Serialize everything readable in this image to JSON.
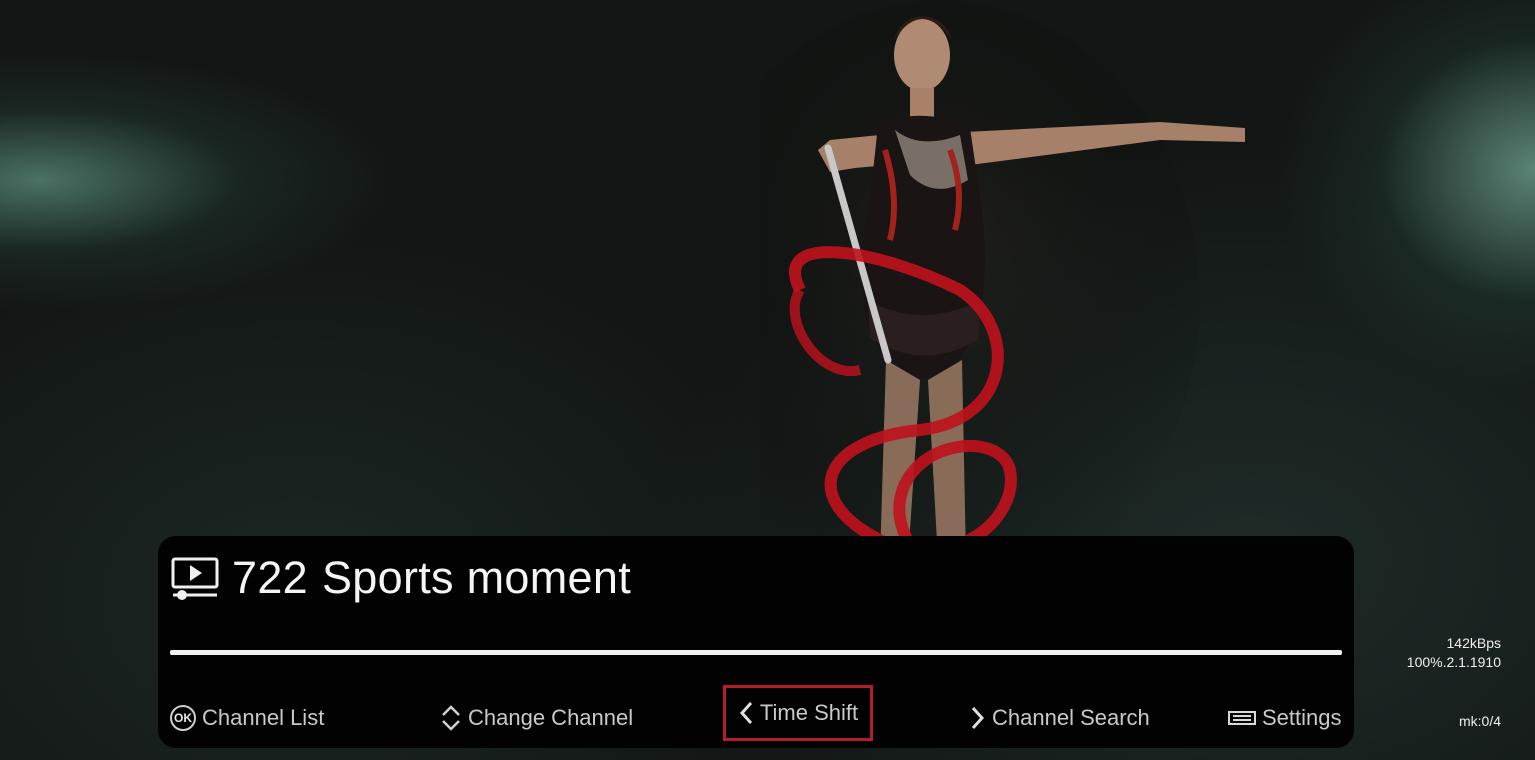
{
  "channel": {
    "number": "722",
    "name": "Sports moment",
    "progress": 1.0
  },
  "hints": {
    "ok": {
      "badge": "OK",
      "label": "Channel List"
    },
    "change": {
      "label": "Change Channel"
    },
    "timeshift": {
      "label": "Time Shift"
    },
    "search": {
      "label": "Channel Search"
    },
    "settings": {
      "label": "Settings"
    }
  },
  "stats": {
    "rate": "142kBps",
    "signal": "100%.2.1.1910",
    "mk": "mk:0/4"
  },
  "icons": {
    "channel": "tv-play-icon",
    "change": "up-down-chevron-icon",
    "timeshift": "chevron-left-icon",
    "search": "chevron-right-icon",
    "settings": "menu-key-icon"
  },
  "colors": {
    "focus_border": "#b0202a",
    "panel": "#020202",
    "ribbon": "#c0121c"
  }
}
